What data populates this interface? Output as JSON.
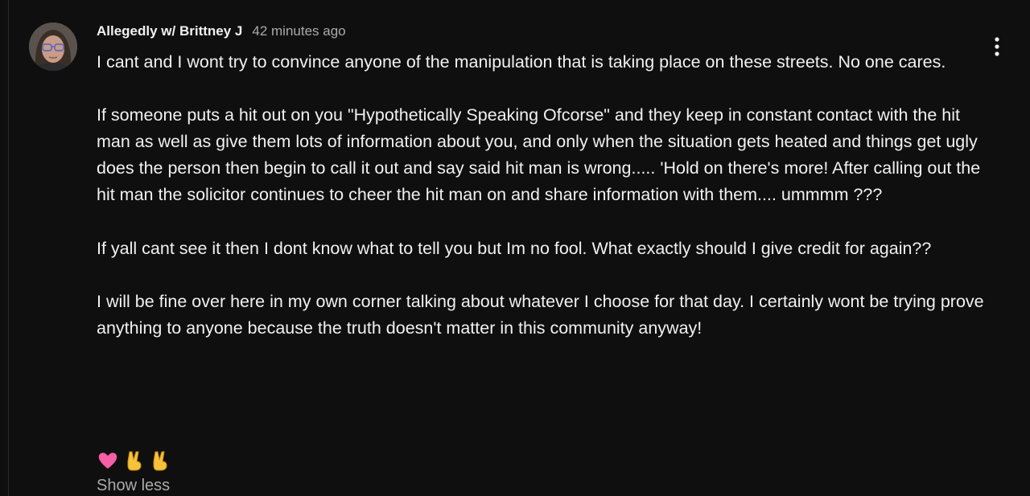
{
  "comment": {
    "author": "Allegedly w/ Brittney J",
    "timestamp": "42 minutes ago",
    "paragraphs": [
      "I cant and I wont try to convince anyone of the manipulation that is taking place on these streets.  No one cares.",
      "If someone puts a hit out on you \"Hypothetically Speaking Ofcorse\" and they keep in constant contact with the hit man as well as give them lots of information about you, and only when the situation gets heated and things get ugly does the person then begin to call it out and say said hit man is wrong..... 'Hold on there's more!  After calling out the hit man the solicitor continues to cheer the hit man on and share information with them.... ummmm ???",
      "If yall cant see it then I dont know what to tell you but Im no fool.   What exactly should I give credit for again??",
      "I will be fine over here in my own corner talking about whatever I choose for that day.  I certainly wont be trying prove anything to anyone because the truth doesn't matter in this community anyway!"
    ],
    "emojis": [
      "pink-heart-icon",
      "victory-hand-icon",
      "victory-hand-icon"
    ],
    "show_less_label": "Show less"
  },
  "colors": {
    "background": "#0f0f0f",
    "text_primary": "#f1f1f1",
    "text_secondary": "#aaaaaa",
    "heart": "#f45fa6",
    "hand": "#f7c23a"
  }
}
